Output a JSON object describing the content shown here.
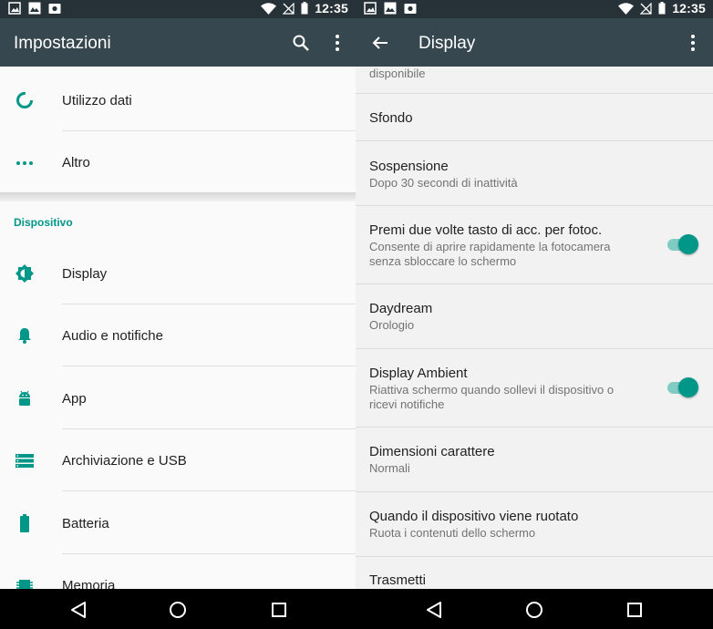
{
  "status": {
    "time_left": "12:35",
    "time_right": "12:35"
  },
  "left": {
    "title": "Impostazioni",
    "items_top": [
      {
        "label": "Utilizzo dati",
        "icon": "data-usage-icon"
      },
      {
        "label": "Altro",
        "icon": "more-horiz-icon"
      }
    ],
    "section": "Dispositivo",
    "items": [
      {
        "label": "Display",
        "icon": "brightness-icon"
      },
      {
        "label": "Audio e notifiche",
        "icon": "bell-icon"
      },
      {
        "label": "App",
        "icon": "android-icon"
      },
      {
        "label": "Archiviazione e USB",
        "icon": "storage-icon"
      },
      {
        "label": "Batteria",
        "icon": "battery-icon"
      },
      {
        "label": "Memoria",
        "icon": "memory-icon"
      }
    ]
  },
  "right": {
    "title": "Display",
    "partial_top": "disponibile",
    "items": [
      {
        "title": "Sfondo",
        "subtitle": ""
      },
      {
        "title": "Sospensione",
        "subtitle": "Dopo 30 secondi di inattività"
      },
      {
        "title": "Premi due volte tasto di acc. per fotoc.",
        "subtitle": "Consente di aprire rapidamente la fotocamera senza sbloccare lo schermo",
        "toggle": true
      },
      {
        "title": "Daydream",
        "subtitle": "Orologio"
      },
      {
        "title": "Display Ambient",
        "subtitle": "Riattiva schermo quando sollevi il dispositivo o ricevi notifiche",
        "toggle": true
      },
      {
        "title": "Dimensioni carattere",
        "subtitle": "Normali"
      },
      {
        "title": "Quando il dispositivo viene ruotato",
        "subtitle": "Ruota i contenuti dello schermo"
      },
      {
        "title": "Trasmetti",
        "subtitle": ""
      }
    ]
  },
  "colors": {
    "accent": "#009688",
    "toolbar": "#37474f",
    "statusbar": "#263238"
  }
}
